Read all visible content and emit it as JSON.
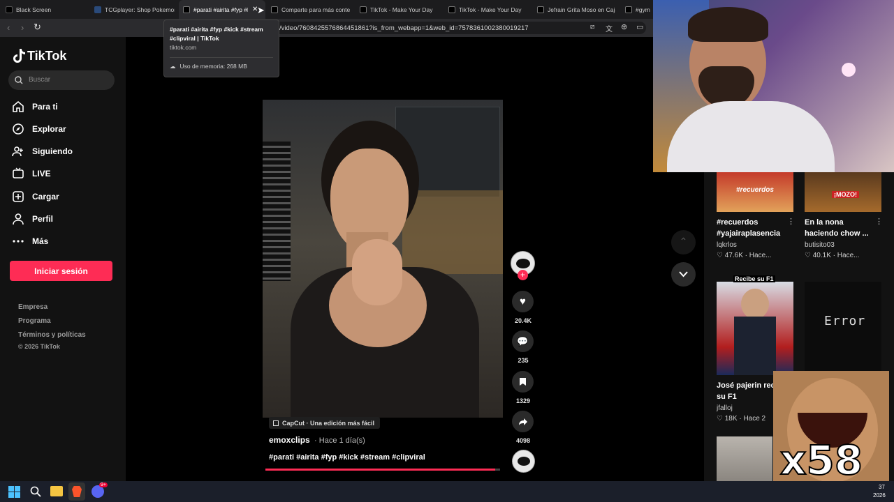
{
  "browser": {
    "tabs": [
      {
        "label": "Black Screen",
        "active": false
      },
      {
        "label": "TCGplayer: Shop Pokemon",
        "active": false
      },
      {
        "label": "#parati #airita #fyp #k",
        "active": true
      },
      {
        "label": "Comparte para más conte",
        "active": false
      },
      {
        "label": "TikTok - Make Your Day",
        "active": false
      },
      {
        "label": "TikTok - Make Your Day",
        "active": false
      },
      {
        "label": "Jefrain Grita Moso en Caja",
        "active": false
      },
      {
        "label": "#gym",
        "active": false
      }
    ],
    "url": "/video/7608425576864451861?is_from_webapp=1&web_id=7578361002380019217",
    "tooltip": {
      "title": "#parati #airita #fyp #kick #stream #clipviral | TikTok",
      "domain": "tiktok.com",
      "memory": "Uso de memoria: 268 MB"
    }
  },
  "sidebar": {
    "logo": "TikTok",
    "search_placeholder": "Buscar",
    "nav": [
      {
        "label": "Para ti",
        "icon": "home-icon"
      },
      {
        "label": "Explorar",
        "icon": "compass-icon"
      },
      {
        "label": "Siguiendo",
        "icon": "people-icon"
      },
      {
        "label": "LIVE",
        "icon": "live-icon"
      },
      {
        "label": "Cargar",
        "icon": "upload-icon"
      },
      {
        "label": "Perfil",
        "icon": "profile-icon"
      },
      {
        "label": "Más",
        "icon": "more-icon"
      }
    ],
    "login_label": "Iniciar sesión",
    "footer": [
      "Empresa",
      "Programa",
      "Términos y políticas",
      "© 2026 TikTok"
    ]
  },
  "video": {
    "capcut_label": "CapCut · Una edición más fácil",
    "author": "emoxclips",
    "time": "· Hace 1 día(s)",
    "caption": "#parati #airita #fyp #kick #stream #clipviral",
    "progress": 0.98,
    "likes": "20.4K",
    "comments": "235",
    "saves": "1329",
    "shares": "4098"
  },
  "recommended": [
    {
      "title": "#recuerdos #yajairaplasencia",
      "user": "lqkrlos",
      "likes": "47.6K",
      "time": "Hace...",
      "thumb_text": "#recuerdos"
    },
    {
      "title": "En la nona haciendo chow ...",
      "user": "butisito03",
      "likes": "40.1K",
      "time": "Hace...",
      "thumb_text": "¡MOZO!"
    },
    {
      "title": "José pajerin rec",
      "title2": "su F1",
      "user": "jfalloj",
      "likes": "18K",
      "time": "Hace 2",
      "thumb_text": "Recibe su F1"
    },
    {
      "thumb_text": "Error"
    }
  ],
  "overlay": {
    "multiplier": "x58"
  },
  "taskbar": {
    "time": "37",
    "date": "2026",
    "discord_badge": "9+"
  },
  "colors": {
    "accent": "#fe2c55",
    "sidebar_bg": "#121212",
    "tab_bg": "#1c1c1e"
  }
}
